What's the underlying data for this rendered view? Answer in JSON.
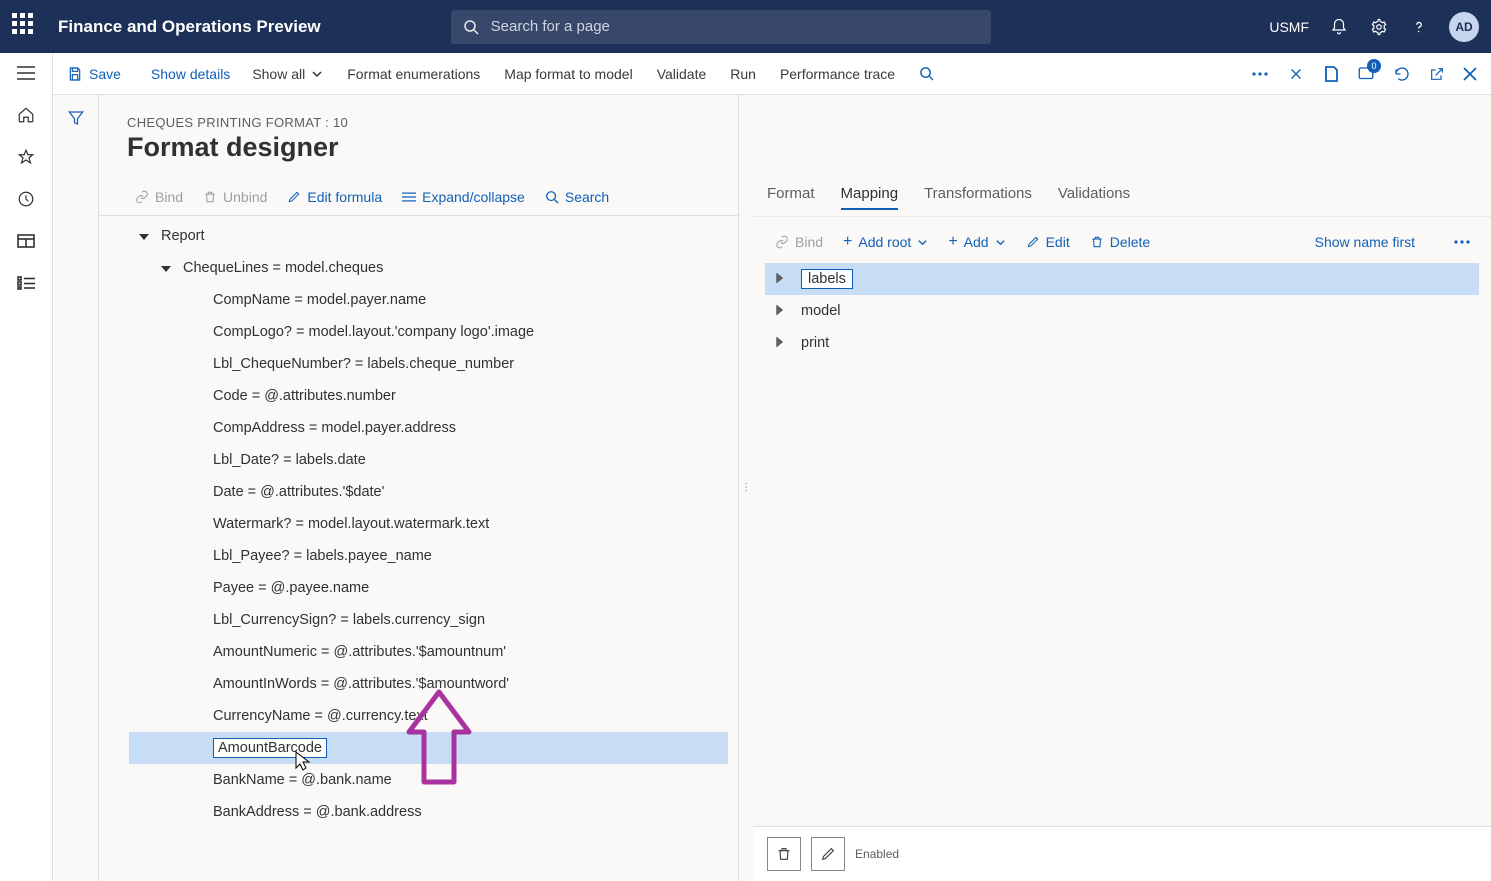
{
  "app_title": "Finance and Operations Preview",
  "search_placeholder": "Search for a page",
  "top_right": {
    "entity": "USMF",
    "avatar_initials": "AD"
  },
  "cmdbar": {
    "save": "Save",
    "show_details": "Show details",
    "show_all": "Show all",
    "format_enum": "Format enumerations",
    "map_format": "Map format to model",
    "validate": "Validate",
    "run": "Run",
    "perf_trace": "Performance trace",
    "badge": "0"
  },
  "page": {
    "breadcrumb": "CHEQUES PRINTING FORMAT : 10",
    "title": "Format designer"
  },
  "lp_toolbar": {
    "bind": "Bind",
    "unbind": "Unbind",
    "edit_formula": "Edit formula",
    "expand_collapse": "Expand/collapse",
    "search": "Search"
  },
  "tree": [
    {
      "indent": 0,
      "label": "Report",
      "expander": "open",
      "selected": false
    },
    {
      "indent": 1,
      "label": "ChequeLines = model.cheques",
      "expander": "open",
      "selected": false
    },
    {
      "indent": 2,
      "label": "CompName = model.payer.name",
      "selected": false
    },
    {
      "indent": 2,
      "label": "CompLogo? = model.layout.'company logo'.image",
      "selected": false
    },
    {
      "indent": 2,
      "label": "Lbl_ChequeNumber? = labels.cheque_number",
      "selected": false
    },
    {
      "indent": 2,
      "label": "Code = @.attributes.number",
      "selected": false
    },
    {
      "indent": 2,
      "label": "CompAddress = model.payer.address",
      "selected": false
    },
    {
      "indent": 2,
      "label": "Lbl_Date? = labels.date",
      "selected": false
    },
    {
      "indent": 2,
      "label": "Date = @.attributes.'$date'",
      "selected": false
    },
    {
      "indent": 2,
      "label": "Watermark? = model.layout.watermark.text",
      "selected": false
    },
    {
      "indent": 2,
      "label": "Lbl_Payee? = labels.payee_name",
      "selected": false
    },
    {
      "indent": 2,
      "label": "Payee = @.payee.name",
      "selected": false
    },
    {
      "indent": 2,
      "label": "Lbl_CurrencySign? = labels.currency_sign",
      "selected": false
    },
    {
      "indent": 2,
      "label": "AmountNumeric = @.attributes.'$amountnum'",
      "selected": false
    },
    {
      "indent": 2,
      "label": "AmountInWords = @.attributes.'$amountword'",
      "selected": false
    },
    {
      "indent": 2,
      "label": "CurrencyName = @.currency.text",
      "selected": false
    },
    {
      "indent": 2,
      "label": "AmountBarcode",
      "selected": true
    },
    {
      "indent": 2,
      "label": "BankName = @.bank.name",
      "selected": false
    },
    {
      "indent": 2,
      "label": "BankAddress = @.bank.address",
      "selected": false
    }
  ],
  "tabs": {
    "format": "Format",
    "mapping": "Mapping",
    "transformations": "Transformations",
    "validations": "Validations"
  },
  "rp_toolbar": {
    "bind": "Bind",
    "add_root": "Add root",
    "add": "Add",
    "edit": "Edit",
    "delete": "Delete",
    "show_name_first": "Show name first"
  },
  "rp_tree": [
    {
      "label": "labels",
      "selected": true
    },
    {
      "label": "model",
      "selected": false
    },
    {
      "label": "print",
      "selected": false
    }
  ],
  "bottom": {
    "enabled": "Enabled"
  }
}
